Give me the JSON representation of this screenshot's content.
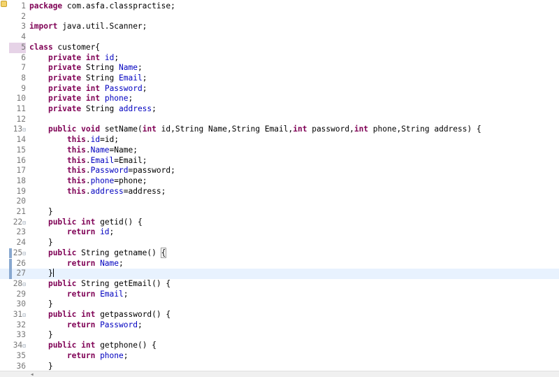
{
  "editor": {
    "current_line": 27,
    "lines": [
      {
        "n": "1",
        "code": [
          {
            "t": "package",
            "k": "kw"
          },
          {
            "t": " com.asfa.classpractise;"
          }
        ]
      },
      {
        "n": "2",
        "code": []
      },
      {
        "n": "3",
        "code": [
          {
            "t": "import",
            "k": "kw"
          },
          {
            "t": " java.util.Scanner;"
          }
        ]
      },
      {
        "n": "4",
        "code": []
      },
      {
        "n": "5",
        "marked": true,
        "code": [
          {
            "t": "class",
            "k": "kw"
          },
          {
            "t": " customer{"
          }
        ]
      },
      {
        "n": "6",
        "code": [
          {
            "t": "    "
          },
          {
            "t": "private",
            "k": "kw"
          },
          {
            "t": " "
          },
          {
            "t": "int",
            "k": "kw"
          },
          {
            "t": " "
          },
          {
            "t": "id",
            "k": "fld"
          },
          {
            "t": ";"
          }
        ]
      },
      {
        "n": "7",
        "code": [
          {
            "t": "    "
          },
          {
            "t": "private",
            "k": "kw"
          },
          {
            "t": " String "
          },
          {
            "t": "Name",
            "k": "fld"
          },
          {
            "t": ";"
          }
        ]
      },
      {
        "n": "8",
        "code": [
          {
            "t": "    "
          },
          {
            "t": "private",
            "k": "kw"
          },
          {
            "t": " String "
          },
          {
            "t": "Email",
            "k": "fld"
          },
          {
            "t": ";"
          }
        ]
      },
      {
        "n": "9",
        "code": [
          {
            "t": "    "
          },
          {
            "t": "private",
            "k": "kw"
          },
          {
            "t": " "
          },
          {
            "t": "int",
            "k": "kw"
          },
          {
            "t": " "
          },
          {
            "t": "Password",
            "k": "fld"
          },
          {
            "t": ";"
          }
        ]
      },
      {
        "n": "10",
        "code": [
          {
            "t": "    "
          },
          {
            "t": "private",
            "k": "kw"
          },
          {
            "t": " "
          },
          {
            "t": "int",
            "k": "kw"
          },
          {
            "t": " "
          },
          {
            "t": "phone",
            "k": "fld"
          },
          {
            "t": ";"
          }
        ]
      },
      {
        "n": "11",
        "code": [
          {
            "t": "    "
          },
          {
            "t": "private",
            "k": "kw"
          },
          {
            "t": " String "
          },
          {
            "t": "address",
            "k": "fld"
          },
          {
            "t": ";"
          }
        ]
      },
      {
        "n": "12",
        "code": []
      },
      {
        "n": "13",
        "fold": true,
        "code": [
          {
            "t": "    "
          },
          {
            "t": "public",
            "k": "kw"
          },
          {
            "t": " "
          },
          {
            "t": "void",
            "k": "kw"
          },
          {
            "t": " setName("
          },
          {
            "t": "int",
            "k": "kw"
          },
          {
            "t": " id,String Name,String Email,"
          },
          {
            "t": "int",
            "k": "kw"
          },
          {
            "t": " password,"
          },
          {
            "t": "int",
            "k": "kw"
          },
          {
            "t": " phone,String address) {"
          }
        ]
      },
      {
        "n": "14",
        "code": [
          {
            "t": "        "
          },
          {
            "t": "this",
            "k": "kw"
          },
          {
            "t": "."
          },
          {
            "t": "id",
            "k": "fld"
          },
          {
            "t": "=id;"
          }
        ]
      },
      {
        "n": "15",
        "code": [
          {
            "t": "        "
          },
          {
            "t": "this",
            "k": "kw"
          },
          {
            "t": "."
          },
          {
            "t": "Name",
            "k": "fld"
          },
          {
            "t": "=Name;"
          }
        ]
      },
      {
        "n": "16",
        "code": [
          {
            "t": "        "
          },
          {
            "t": "this",
            "k": "kw"
          },
          {
            "t": "."
          },
          {
            "t": "Email",
            "k": "fld"
          },
          {
            "t": "=Email;"
          }
        ]
      },
      {
        "n": "17",
        "code": [
          {
            "t": "        "
          },
          {
            "t": "this",
            "k": "kw"
          },
          {
            "t": "."
          },
          {
            "t": "Password",
            "k": "fld"
          },
          {
            "t": "=password;"
          }
        ]
      },
      {
        "n": "18",
        "code": [
          {
            "t": "        "
          },
          {
            "t": "this",
            "k": "kw"
          },
          {
            "t": "."
          },
          {
            "t": "phone",
            "k": "fld"
          },
          {
            "t": "=phone;"
          }
        ]
      },
      {
        "n": "19",
        "code": [
          {
            "t": "        "
          },
          {
            "t": "this",
            "k": "kw"
          },
          {
            "t": "."
          },
          {
            "t": "address",
            "k": "fld"
          },
          {
            "t": "=address;"
          }
        ]
      },
      {
        "n": "20",
        "code": []
      },
      {
        "n": "21",
        "code": [
          {
            "t": "    }"
          }
        ]
      },
      {
        "n": "22",
        "fold": true,
        "code": [
          {
            "t": "    "
          },
          {
            "t": "public",
            "k": "kw"
          },
          {
            "t": " "
          },
          {
            "t": "int",
            "k": "kw"
          },
          {
            "t": " getid() {"
          }
        ]
      },
      {
        "n": "23",
        "code": [
          {
            "t": "        "
          },
          {
            "t": "return",
            "k": "kw"
          },
          {
            "t": " "
          },
          {
            "t": "id",
            "k": "fld"
          },
          {
            "t": ";"
          }
        ]
      },
      {
        "n": "24",
        "code": [
          {
            "t": "    }"
          }
        ]
      },
      {
        "n": "25",
        "fold": true,
        "change": true,
        "code": [
          {
            "t": "    "
          },
          {
            "t": "public",
            "k": "kw"
          },
          {
            "t": " String getname() "
          },
          {
            "t": "{",
            "k": "box"
          }
        ]
      },
      {
        "n": "26",
        "change": true,
        "code": [
          {
            "t": "        "
          },
          {
            "t": "return",
            "k": "kw"
          },
          {
            "t": " "
          },
          {
            "t": "Name",
            "k": "fld"
          },
          {
            "t": ";"
          }
        ]
      },
      {
        "n": "27",
        "change": true,
        "code": [
          {
            "t": "    }"
          },
          {
            "t": "",
            "k": "caret"
          }
        ]
      },
      {
        "n": "28",
        "fold": true,
        "code": [
          {
            "t": "    "
          },
          {
            "t": "public",
            "k": "kw"
          },
          {
            "t": " String getEmail() {"
          }
        ]
      },
      {
        "n": "29",
        "code": [
          {
            "t": "        "
          },
          {
            "t": "return",
            "k": "kw"
          },
          {
            "t": " "
          },
          {
            "t": "Email",
            "k": "fld"
          },
          {
            "t": ";"
          }
        ]
      },
      {
        "n": "30",
        "code": [
          {
            "t": "    }"
          }
        ]
      },
      {
        "n": "31",
        "fold": true,
        "code": [
          {
            "t": "    "
          },
          {
            "t": "public",
            "k": "kw"
          },
          {
            "t": " "
          },
          {
            "t": "int",
            "k": "kw"
          },
          {
            "t": " getpassword() {"
          }
        ]
      },
      {
        "n": "32",
        "code": [
          {
            "t": "        "
          },
          {
            "t": "return",
            "k": "kw"
          },
          {
            "t": " "
          },
          {
            "t": "Password",
            "k": "fld"
          },
          {
            "t": ";"
          }
        ]
      },
      {
        "n": "33",
        "code": [
          {
            "t": "    }"
          }
        ]
      },
      {
        "n": "34",
        "fold": true,
        "code": [
          {
            "t": "    "
          },
          {
            "t": "public",
            "k": "kw"
          },
          {
            "t": " "
          },
          {
            "t": "int",
            "k": "kw"
          },
          {
            "t": " getphone() {"
          }
        ]
      },
      {
        "n": "35",
        "code": [
          {
            "t": "        "
          },
          {
            "t": "return",
            "k": "kw"
          },
          {
            "t": " "
          },
          {
            "t": "phone",
            "k": "fld"
          },
          {
            "t": ";"
          }
        ]
      },
      {
        "n": "36",
        "code": [
          {
            "t": "    }"
          }
        ]
      }
    ]
  },
  "colors": {
    "keyword": "#7f0055",
    "field": "#0000c0",
    "line_number": "#787878",
    "current_line_bg": "#e8f2fe"
  },
  "icons": {
    "fold": "fold-collapse-icon",
    "warning": "warning-icon",
    "scroll_left": "scroll-left-arrow-icon"
  }
}
